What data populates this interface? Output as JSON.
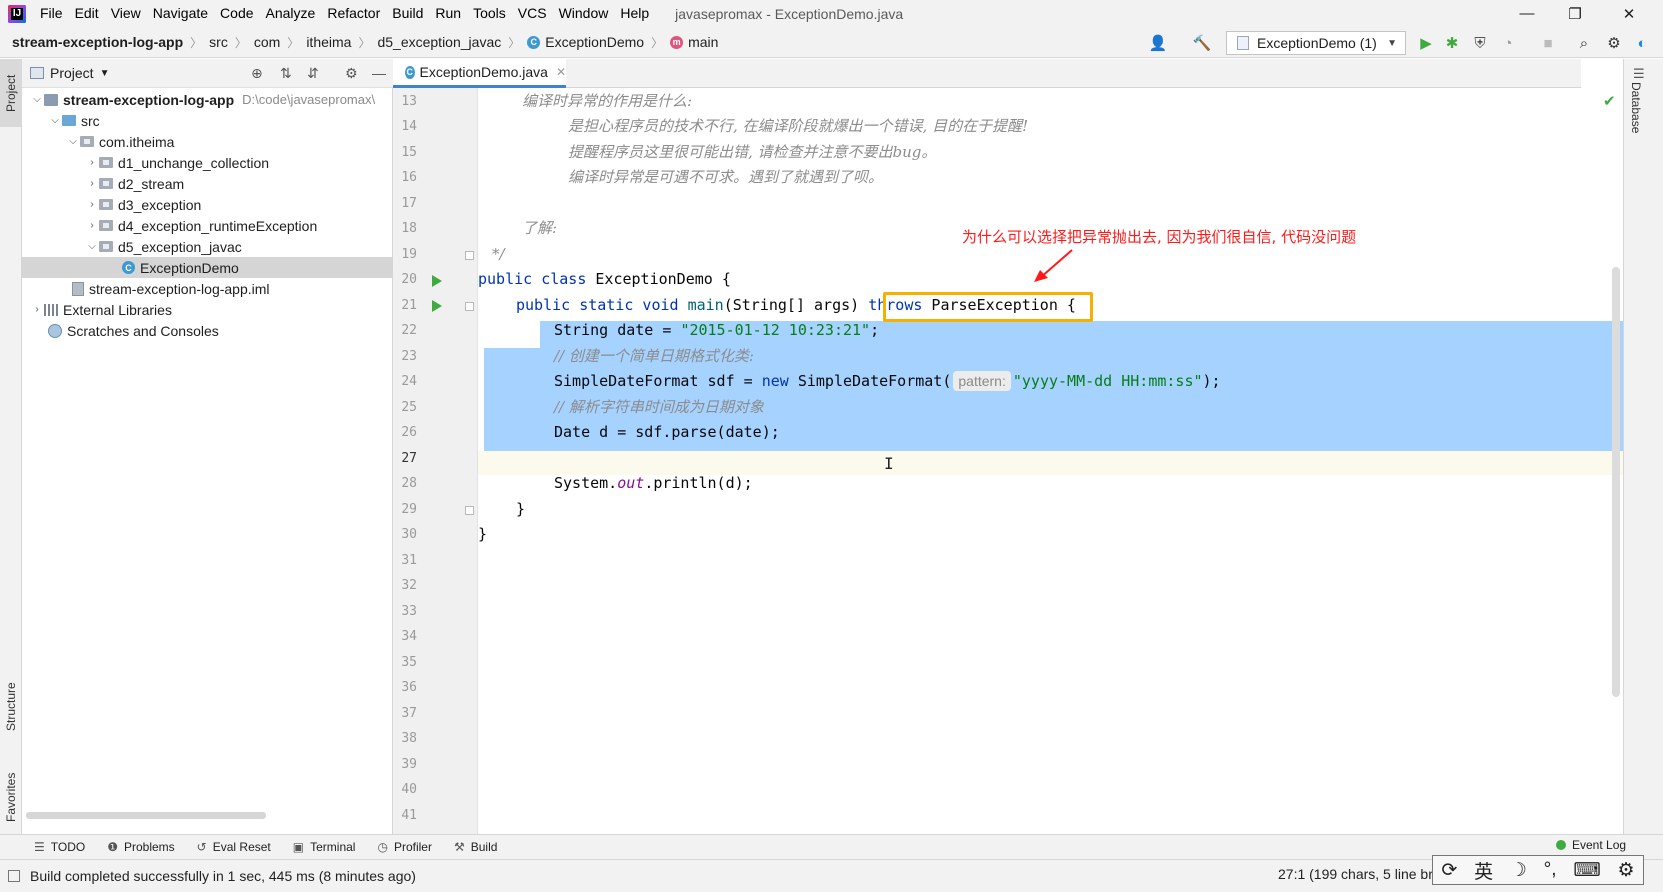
{
  "menubar": {
    "logo": "IJ",
    "items": [
      "File",
      "Edit",
      "View",
      "Navigate",
      "Code",
      "Analyze",
      "Refactor",
      "Build",
      "Run",
      "Tools",
      "VCS",
      "Window",
      "Help"
    ],
    "window_title": "javasepromax - ExceptionDemo.java"
  },
  "breadcrumbs": {
    "project": "stream-exception-log-app",
    "src": "src",
    "com": "com",
    "pkg": "itheima",
    "folder": "d5_exception_javac",
    "class": "ExceptionDemo",
    "method": "main"
  },
  "run_config": {
    "label": "ExceptionDemo (1)"
  },
  "project_panel": {
    "title": "Project",
    "tree": {
      "root": "stream-exception-log-app",
      "root_path": "D:\\code\\javasepromax\\",
      "src": "src",
      "package": "com.itheima",
      "d1": "d1_unchange_collection",
      "d2": "d2_stream",
      "d3": "d3_exception",
      "d4": "d4_exception_runtimeException",
      "d5": "d5_exception_javac",
      "selected_file": "ExceptionDemo",
      "iml": "stream-exception-log-app.iml",
      "external": "External Libraries",
      "scratches": "Scratches and Consoles"
    }
  },
  "left_stripe": {
    "project": "Project",
    "structure": "Structure",
    "favorites": "Favorites"
  },
  "right_stripe": {
    "database": "Database"
  },
  "editor": {
    "tab_label": "ExceptionDemo.java",
    "line_numbers": [
      "13",
      "14",
      "15",
      "16",
      "17",
      "18",
      "19",
      "20",
      "21",
      "22",
      "23",
      "24",
      "25",
      "26",
      "27",
      "28",
      "29",
      "30",
      "31",
      "32",
      "33",
      "34",
      "35",
      "36",
      "37",
      "38",
      "39",
      "40",
      "41"
    ],
    "lines": {
      "l13": "编译时异常的作用是什么:",
      "l14": "是担心程序员的技术不行, 在编译阶段就爆出一个错误, 目的在于提醒!",
      "l15": "提醒程序员这里很可能出错, 请检查并注意不要出bug。",
      "l16": "编译时异常是可遇不可求。遇到了就遇到了呗。",
      "l18": "了解:",
      "l19": "*/",
      "l20_kw": "public class",
      "l20_rest": " ExceptionDemo {",
      "l21_kw": "public static void",
      "l21_name": "main",
      "l21_args": "(String[] args) ",
      "l21_throws": "throws",
      "l21_exc": " ParseException",
      "l21_brace": " {",
      "l22_a": "String date = ",
      "l22_str": "\"2015-01-12 10:23:21\"",
      "l22_end": ";",
      "l23": "// 创建一个简单日期格式化类:",
      "l24_a": "SimpleDateFormat sdf = ",
      "l24_kw": "new",
      "l24_b": " SimpleDateFormat(",
      "l24_hint": "pattern:",
      "l24_str": "\"yyyy-MM-dd HH:mm:ss\"",
      "l24_end": ");",
      "l25": "// 解析字符串时间成为日期对象",
      "l26": "Date d = sdf.parse(date);",
      "l28_a": "System.",
      "l28_field": "out",
      "l28_b": ".println(d);",
      "l29": "}",
      "l30": "}"
    },
    "annotation": "为什么可以选择把异常抛出去, 因为我们很自信, 代码没问题"
  },
  "bottom_tools": [
    "TODO",
    "Problems",
    "Eval Reset",
    "Terminal",
    "Profiler",
    "Build"
  ],
  "event_log": "Event Log",
  "status": {
    "message": "Build completed successfully in 1 sec, 445 ms (8 minutes ago)",
    "caret": "27:1 (199 chars, 5 line br"
  },
  "ime": {
    "lang": "英"
  },
  "colors": {
    "keyword": "#0033b3",
    "string": "#067d17",
    "selection": "#a6d2ff",
    "annotation": "#ff1a1a",
    "highlight_box": "#f5b000",
    "run": "#3faa3f"
  }
}
